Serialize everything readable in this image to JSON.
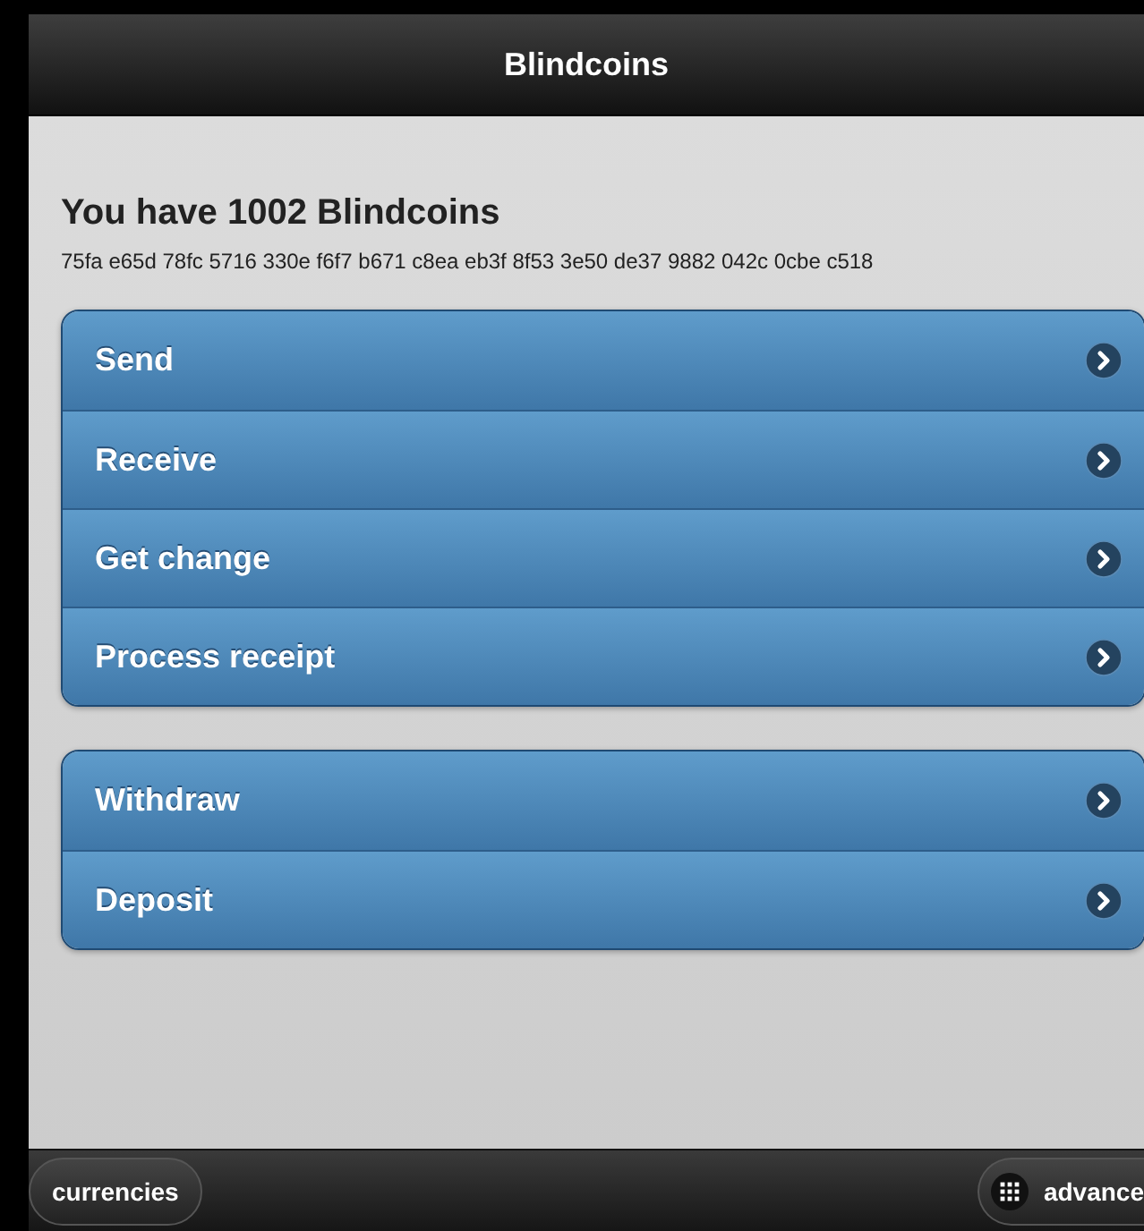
{
  "header": {
    "title": "Blindcoins"
  },
  "balance": {
    "heading": "You have 1002 Blindcoins",
    "hash": "75fa e65d 78fc 5716 330e f6f7 b671 c8ea eb3f 8f53 3e50 de37 9882 042c 0cbe c518"
  },
  "menu_groups": [
    {
      "items": [
        {
          "label": "Send"
        },
        {
          "label": "Receive"
        },
        {
          "label": "Get change"
        },
        {
          "label": "Process receipt"
        }
      ]
    },
    {
      "items": [
        {
          "label": "Withdraw"
        },
        {
          "label": "Deposit"
        }
      ]
    }
  ],
  "footer": {
    "left_button": "currencies",
    "right_button": "advance"
  }
}
